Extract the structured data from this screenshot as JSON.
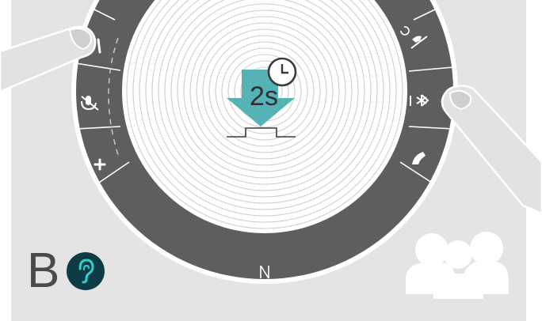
{
  "figure": {
    "label": "B",
    "duration": "2s",
    "icons": [
      "volume-down-icon",
      "mute-microphone-icon",
      "volume-up-icon",
      "phone-reject-icon",
      "bluetooth-icon",
      "phone-accept-icon",
      "nfc-icon",
      "clock-icon",
      "hearing-icon",
      "people-group-icon",
      "finger-left-icon",
      "finger-right-icon",
      "press-down-arrow-icon",
      "button-symbol-icon"
    ],
    "colors": {
      "background": "#e4e4e4",
      "ring": "#5e5e5e",
      "speaker": "#ffffff",
      "arrow": "#55b3b6",
      "badge": "#0f3c44",
      "badge_icon": "#2fd0c8"
    }
  }
}
